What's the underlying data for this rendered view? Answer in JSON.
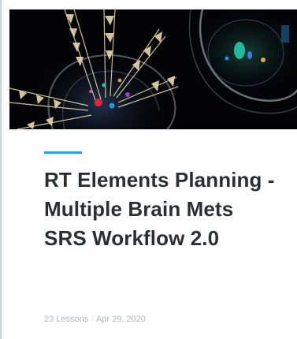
{
  "card": {
    "title": "RT Elements Planning - Multiple Brain Mets SRS Workflow 2.0",
    "lessons": "23 Lessons",
    "separator": "·",
    "date": "Apr 29, 2020",
    "accent_color": "#2aa7d8",
    "thumbnail_icon": "brain-radiotherapy-thumbnail"
  }
}
